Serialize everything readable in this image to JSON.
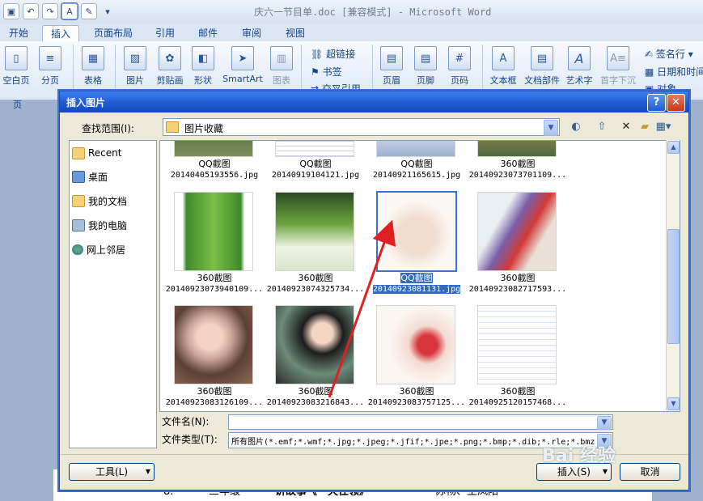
{
  "window": {
    "title": "庆六一节目单.doc [兼容模式] - Microsoft Word"
  },
  "ribbon": {
    "tabs": [
      "开始",
      "插入",
      "页面布局",
      "引用",
      "邮件",
      "审阅",
      "视图"
    ],
    "active_tab": "插入",
    "buttons": [
      "空白页",
      "分页",
      "表格",
      "图片",
      "剪贴画",
      "形状",
      "SmartArt",
      "图表",
      "页眉",
      "页脚",
      "页码",
      "文本框",
      "文档部件",
      "艺术字",
      "首字下沉"
    ],
    "links": [
      "超链接",
      "书签",
      "交叉引用"
    ],
    "right_items": [
      "签名行",
      "日期和时间",
      "对象"
    ],
    "group_label": "页"
  },
  "dialog": {
    "title": "插入图片",
    "help": "?",
    "close": "✕",
    "look_in_label": "查找范围(I):",
    "look_in_value": "图片收藏",
    "places": [
      "Recent",
      "桌面",
      "我的文档",
      "我的电脑",
      "网上邻居"
    ],
    "files_row0": [
      {
        "name": "QQ截图",
        "file": "20140405193556.jpg"
      },
      {
        "name": "QQ截图",
        "file": "20140919104121.jpg"
      },
      {
        "name": "QQ截图",
        "file": "20140921165615.jpg"
      },
      {
        "name": "360截图",
        "file": "20140923073701109..."
      }
    ],
    "files_row1": [
      {
        "name": "360截图",
        "file": "20140923073940109..."
      },
      {
        "name": "360截图",
        "file": "20140923074325734..."
      },
      {
        "name": "QQ截图",
        "file": "20140923081131.jpg"
      },
      {
        "name": "360截图",
        "file": "20140923082717593..."
      }
    ],
    "files_row2": [
      {
        "name": "360截图",
        "file": "20140923083126109..."
      },
      {
        "name": "360截图",
        "file": "20140923083216843..."
      },
      {
        "name": "360截图",
        "file": "20140923083757125..."
      },
      {
        "name": "360截图",
        "file": "20140925120157468..."
      }
    ],
    "file_name_label": "文件名(N):",
    "file_name_value": "",
    "file_type_label": "文件类型(T):",
    "file_type_value": "所有图片(*.emf;*.wmf;*.jpg;*.jpeg;*.jfif;*.jpe;*.png;*.bmp;*.dib;*.rle;*.bmz",
    "tools_button": "工具(L)",
    "insert_button": "插入(S)",
    "cancel_button": "取消"
  },
  "document": {
    "row": [
      "8.",
      "三年级",
      "讲故事《一天任领》",
      "苏畅、王凤阳"
    ]
  },
  "watermark": "Bai 经验"
}
